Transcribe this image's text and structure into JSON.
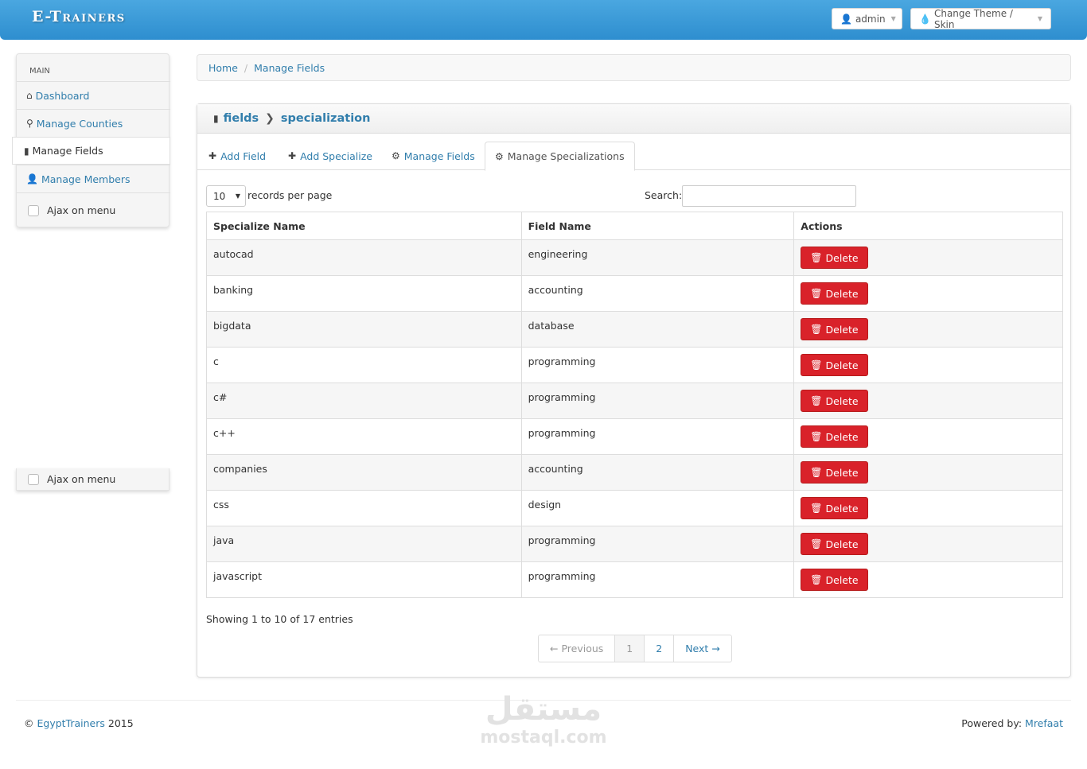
{
  "navbar": {
    "brand": "E-Trainers",
    "user_label": "admin",
    "theme_label": "Change Theme / Skin"
  },
  "sidebar": {
    "header": "MAIN",
    "items": [
      {
        "label": "Dashboard",
        "icon": "home-icon"
      },
      {
        "label": "Manage Counties",
        "icon": "map-marker-icon"
      },
      {
        "label": "Manage Fields",
        "icon": "book-icon",
        "active": true
      },
      {
        "label": "Manage Members",
        "icon": "user-icon"
      }
    ],
    "ajax_label": "Ajax on menu"
  },
  "breadcrumb": {
    "home": "Home",
    "current": "Manage Fields"
  },
  "box": {
    "title_part1": "fields",
    "title_part2": "specialization"
  },
  "tabs": [
    {
      "label": "Add Field",
      "icon": "plus-icon"
    },
    {
      "label": "Add Specialize",
      "icon": "plus-icon"
    },
    {
      "label": "Manage Fields",
      "icon": "cog-icon"
    },
    {
      "label": "Manage Specializations",
      "icon": "cog-icon",
      "active": true
    }
  ],
  "table_controls": {
    "page_length": "10",
    "records_label": "records per page",
    "search_label": "Search:"
  },
  "table": {
    "headers": [
      "Specialize Name",
      "Field Name",
      "Actions"
    ],
    "delete_label": "Delete",
    "rows": [
      {
        "name": "autocad",
        "field": "engineering"
      },
      {
        "name": "banking",
        "field": "accounting"
      },
      {
        "name": "bigdata",
        "field": "database"
      },
      {
        "name": "c",
        "field": "programming"
      },
      {
        "name": "c#",
        "field": "programming"
      },
      {
        "name": "c++",
        "field": "programming"
      },
      {
        "name": "companies",
        "field": "accounting"
      },
      {
        "name": "css",
        "field": "design"
      },
      {
        "name": "java",
        "field": "programming"
      },
      {
        "name": "javascript",
        "field": "programming"
      }
    ]
  },
  "pagination": {
    "info": "Showing 1 to 10 of 17 entries",
    "previous": "← Previous",
    "pages": [
      "1",
      "2"
    ],
    "next": "Next →"
  },
  "footer": {
    "copyright": "©",
    "company": "EgyptTrainers",
    "year": "2015",
    "powered_label": "Powered by:",
    "powered_by": "Mrefaat"
  },
  "watermark": {
    "arabic": "مستقل",
    "latin": "mostaql.com"
  },
  "colors": {
    "navbar": "#3a9ad9",
    "link": "#317eac",
    "danger": "#d9222a"
  }
}
